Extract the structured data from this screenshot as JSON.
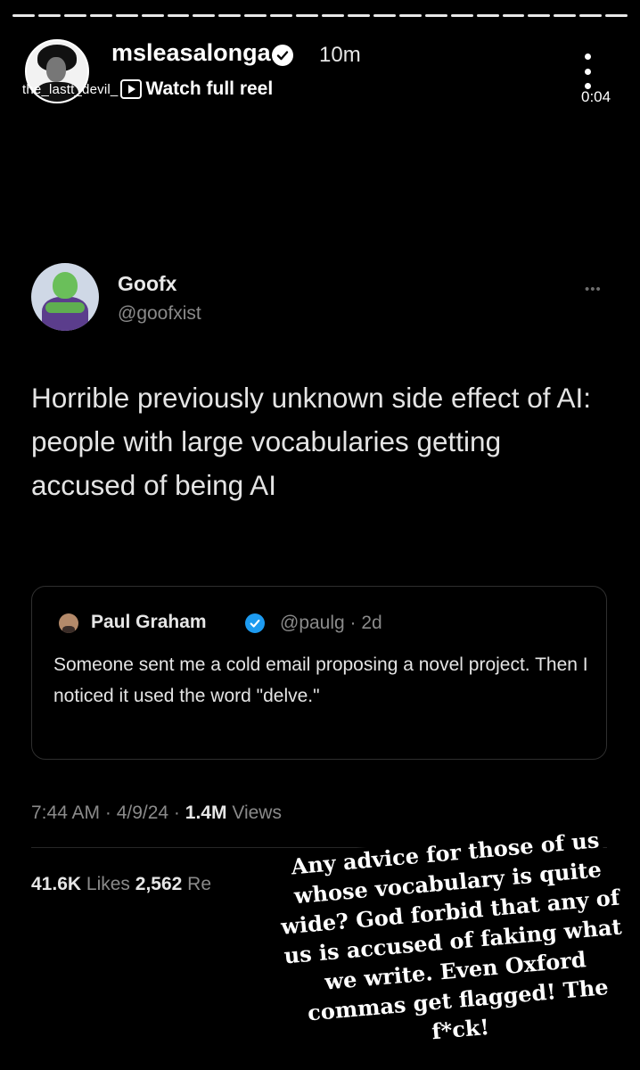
{
  "story": {
    "username": "msleasalonga",
    "time_ago": "10m",
    "audio_track": "the_lastt_devil_",
    "watch_label": "Watch full reel",
    "duration": "0:04",
    "caption": "Any advice for those of us whose vocabulary is quite wide? God forbid that any of us is accused of faking what we write. Even Oxford commas get flagged! The f*ck!"
  },
  "tweet": {
    "name": "Goofx",
    "handle": "@goofxist",
    "more_label": "•••",
    "text": "Horrible previously unknown side effect of AI: people with large vocabularies getting accused of being AI",
    "time": "7:44 AM · 4/9/24 ·",
    "views_count": "1.4M",
    "views_label": "Views",
    "likes_count": "41.6K",
    "likes_label": "Likes",
    "reposts_count": "2,562",
    "reposts_label": "Re",
    "quote": {
      "name": "Paul Graham",
      "handle_time": "@paulg · 2d",
      "text": "Someone sent me a cold email proposing a novel project. Then I noticed it used the word \"delve.\""
    }
  },
  "icons": [
    "verified-badge-icon",
    "reel-play-icon",
    "more-vertical-icon"
  ],
  "colors": {
    "background": "#000000",
    "verified_blue": "#1d9bf0",
    "muted_text": "#8a8a8a"
  }
}
